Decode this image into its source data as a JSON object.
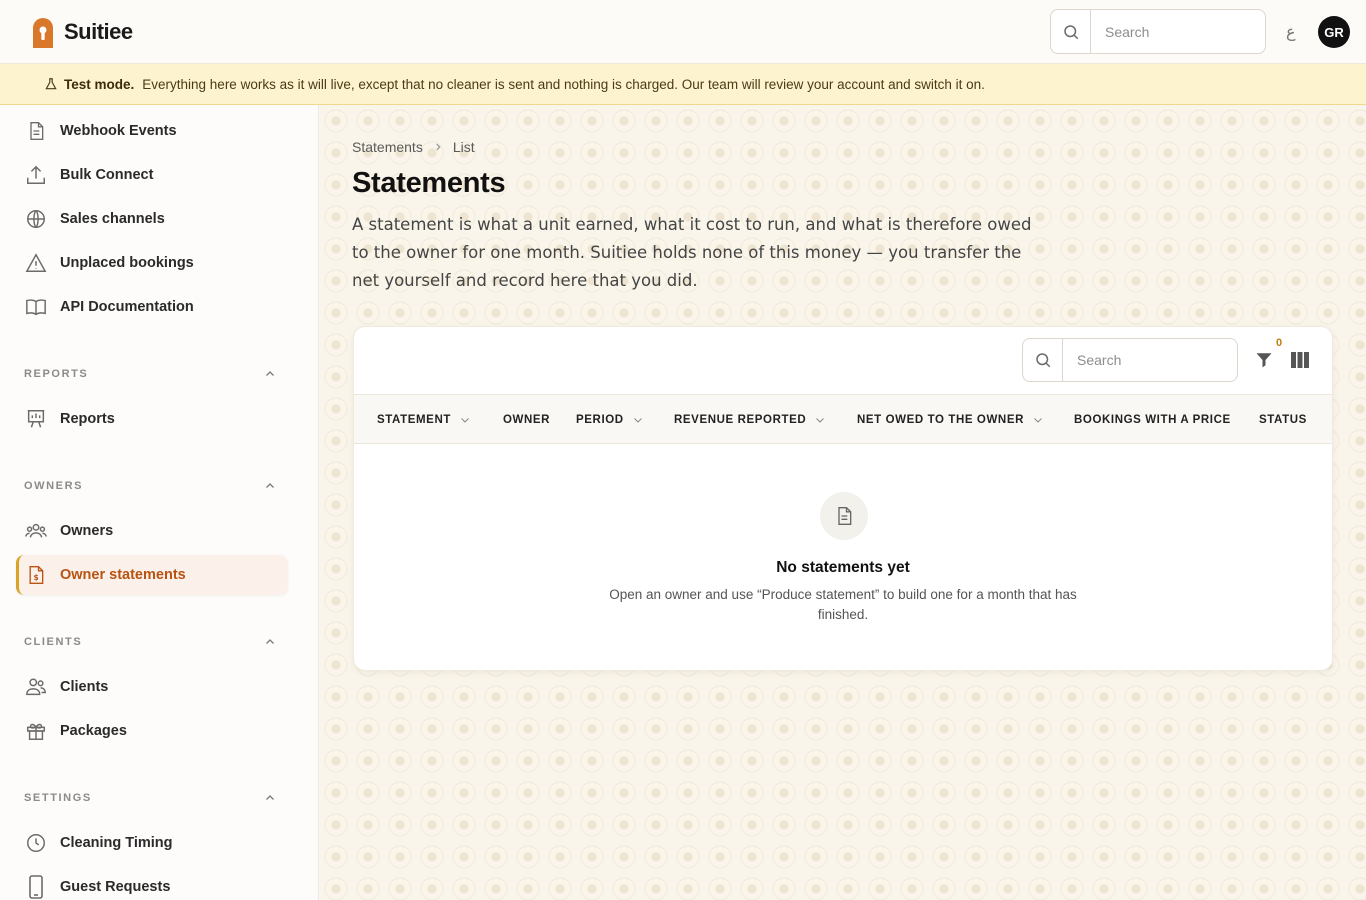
{
  "brand": {
    "name": "Suitiee",
    "accent": "#d9772b"
  },
  "topbar": {
    "search_placeholder": "Search",
    "lang_glyph": "ع",
    "avatar_initials": "GR"
  },
  "banner": {
    "icon": "flask-icon",
    "label": "Test mode.",
    "text": "Everything here works as it will live, except that no cleaner is sent and nothing is charged. Our team will review your account and switch it on."
  },
  "sidebar": {
    "items_top": [
      {
        "label": "Webhook Events",
        "icon": "document-icon"
      },
      {
        "label": "Bulk Connect",
        "icon": "upload-icon"
      },
      {
        "label": "Sales channels",
        "icon": "globe-icon"
      },
      {
        "label": "Unplaced bookings",
        "icon": "warning-icon"
      },
      {
        "label": "API Documentation",
        "icon": "book-icon"
      }
    ],
    "reports": {
      "title": "REPORTS",
      "items": [
        {
          "label": "Reports",
          "icon": "chart-board-icon"
        }
      ]
    },
    "owners": {
      "title": "OWNERS",
      "items": [
        {
          "label": "Owners",
          "icon": "users-icon"
        },
        {
          "label": "Owner statements",
          "icon": "dollar-document-icon",
          "active": true
        }
      ]
    },
    "clients": {
      "title": "CLIENTS",
      "items": [
        {
          "label": "Clients",
          "icon": "user-group-icon"
        },
        {
          "label": "Packages",
          "icon": "gift-icon"
        }
      ]
    },
    "settings": {
      "title": "SETTINGS",
      "items": [
        {
          "label": "Cleaning Timing",
          "icon": "clock-icon"
        },
        {
          "label": "Guest Requests",
          "icon": "phone-icon"
        }
      ]
    }
  },
  "main": {
    "breadcrumb": [
      "Statements",
      "List"
    ],
    "title": "Statements",
    "description": "A statement is what a unit earned, what it cost to run, and what is therefore owed to the owner for one month. Suitiee holds none of this money — you transfer the net yourself and record here that you did.",
    "table": {
      "search_placeholder": "Search",
      "filter_count": "0",
      "columns": [
        "STATEMENT",
        "OWNER",
        "PERIOD",
        "REVENUE REPORTED",
        "NET OWED TO THE OWNER",
        "BOOKINGS WITH A PRICE",
        "STATUS"
      ],
      "empty_title": "No statements yet",
      "empty_text": "Open an owner and use “Produce statement” to build one for a month that has finished."
    }
  }
}
